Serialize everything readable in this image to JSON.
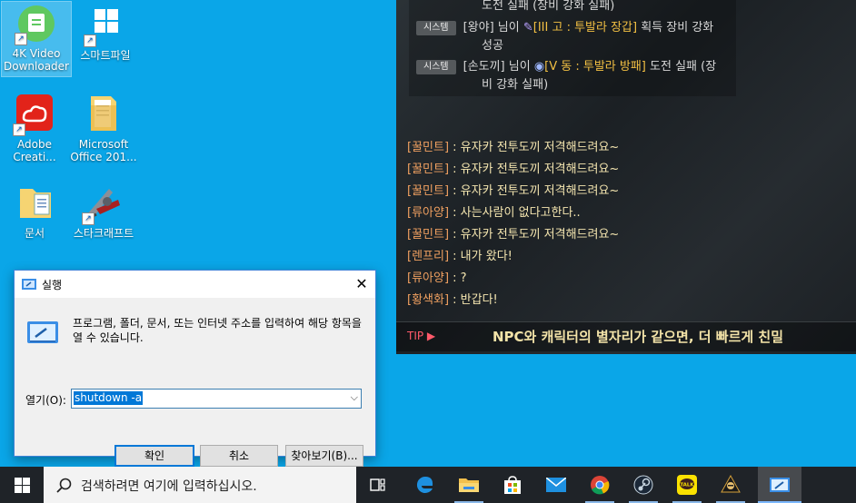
{
  "desktop": {
    "icons": [
      {
        "label": "4K Video Downloader"
      },
      {
        "label": "스마트파일"
      },
      {
        "label": "Adobe Creati..."
      },
      {
        "label": "Microsoft Office 201..."
      },
      {
        "label": "문서"
      },
      {
        "label": "스타크래프트"
      }
    ]
  },
  "game": {
    "system_badge": "시스템",
    "system_lines": [
      {
        "pre": "",
        "item": "",
        "post": "도전 실패 (장비 강화 실패)"
      },
      {
        "pre": "[왕야] 님이 ",
        "item": "[III 고 : 투발라 장갑]",
        "post": " 획득 장비 강화",
        "cont": "성공"
      },
      {
        "pre": "[손도끼] 님이 ",
        "item": "[V 동 : 투발라 방패]",
        "post": " 도전 실패 (장",
        "cont": "비 강화 실패)"
      }
    ],
    "chat": [
      {
        "name": "[꿀민트]",
        "msg": " : 유자카 전투도끼 저격해드려요~"
      },
      {
        "name": "[꿀민트]",
        "msg": " : 유자카 전투도끼 저격해드려요~"
      },
      {
        "name": "[꿀민트]",
        "msg": " : 유자카 전투도끼 저격해드려요~"
      },
      {
        "name": "[류아양]",
        "msg": " : 사는사람이 없다고한다.."
      },
      {
        "name": "[꿀민트]",
        "msg": " : 유자카 전투도끼 저격해드려요~"
      },
      {
        "name": "[렌프리]",
        "msg": " : 내가 왔다!"
      },
      {
        "name": "[류아양]",
        "msg": " : ?"
      },
      {
        "name": "[황색화]",
        "msg": " : 반갑다!"
      }
    ],
    "tip_label": "TIP ▶",
    "tip_text": "NPC와 캐릭터의 별자리가 같으면, 더 빠르게 친밀"
  },
  "run_dialog": {
    "title": "실행",
    "description": "프로그램, 폴더, 문서, 또는 인터넷 주소를 입력하여 해당 항목을 열 수 있습니다.",
    "open_label": "열기(O):",
    "open_value": "shutdown -a",
    "ok_label": "확인",
    "cancel_label": "취소",
    "browse_label": "찾아보기(B)..."
  },
  "taskbar": {
    "search_placeholder": "검색하려면 여기에 입력하십시오.",
    "apps": [
      "task-view",
      "edge",
      "file-explorer",
      "store",
      "mail",
      "chrome",
      "steam",
      "kakaotalk",
      "game-client",
      "run"
    ]
  },
  "colors": {
    "desktop": "#0aa6e8",
    "taskbar": "#1f2328",
    "accent": "#0078d7"
  }
}
